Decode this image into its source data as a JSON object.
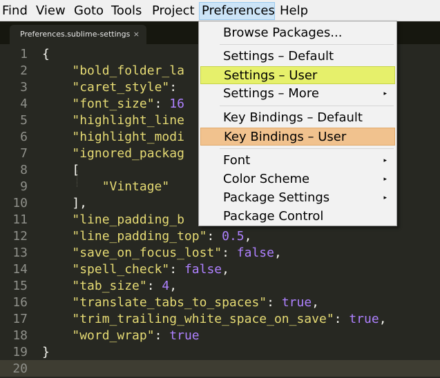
{
  "menubar": {
    "items": [
      {
        "label": "Find"
      },
      {
        "label": "View"
      },
      {
        "label": "Goto"
      },
      {
        "label": "Tools"
      },
      {
        "label": "Project"
      },
      {
        "label": "Preferences"
      },
      {
        "label": "Help"
      }
    ],
    "active": "Preferences"
  },
  "tab": {
    "title": "Preferences.sublime-settings",
    "close": "×"
  },
  "editor": {
    "line_numbers": [
      "1",
      "2",
      "3",
      "4",
      "5",
      "6",
      "7",
      "8",
      "9",
      "10",
      "11",
      "12",
      "13",
      "14",
      "15",
      "16",
      "17",
      "18",
      "19",
      "20"
    ],
    "current_line": 20,
    "lines": [
      [
        {
          "t": "p",
          "v": "{"
        }
      ],
      [
        {
          "t": "p",
          "v": "    "
        },
        {
          "t": "s",
          "v": "\"bold_folder_la"
        }
      ],
      [
        {
          "t": "p",
          "v": "    "
        },
        {
          "t": "s",
          "v": "\"caret_style\""
        },
        {
          "t": "p",
          "v": ":"
        }
      ],
      [
        {
          "t": "p",
          "v": "    "
        },
        {
          "t": "s",
          "v": "\"font_size\""
        },
        {
          "t": "p",
          "v": ": "
        },
        {
          "t": "n",
          "v": "16"
        }
      ],
      [
        {
          "t": "p",
          "v": "    "
        },
        {
          "t": "s",
          "v": "\"highlight_line"
        }
      ],
      [
        {
          "t": "p",
          "v": "    "
        },
        {
          "t": "s",
          "v": "\"highlight_modi"
        }
      ],
      [
        {
          "t": "p",
          "v": "    "
        },
        {
          "t": "s",
          "v": "\"ignored_packag"
        }
      ],
      [
        {
          "t": "p",
          "v": "    ["
        }
      ],
      [
        {
          "t": "p",
          "v": "        "
        },
        {
          "t": "s",
          "v": "\"Vintage\""
        }
      ],
      [
        {
          "t": "p",
          "v": "    ],"
        }
      ],
      [
        {
          "t": "p",
          "v": "    "
        },
        {
          "t": "s",
          "v": "\"line_padding_b"
        }
      ],
      [
        {
          "t": "p",
          "v": "    "
        },
        {
          "t": "s",
          "v": "\"line_padding_top\""
        },
        {
          "t": "p",
          "v": ": "
        },
        {
          "t": "n",
          "v": "0.5"
        },
        {
          "t": "p",
          "v": ","
        }
      ],
      [
        {
          "t": "p",
          "v": "    "
        },
        {
          "t": "s",
          "v": "\"save_on_focus_lost\""
        },
        {
          "t": "p",
          "v": ": "
        },
        {
          "t": "b",
          "v": "false"
        },
        {
          "t": "p",
          "v": ","
        }
      ],
      [
        {
          "t": "p",
          "v": "    "
        },
        {
          "t": "s",
          "v": "\"spell_check\""
        },
        {
          "t": "p",
          "v": ": "
        },
        {
          "t": "b",
          "v": "false"
        },
        {
          "t": "p",
          "v": ","
        }
      ],
      [
        {
          "t": "p",
          "v": "    "
        },
        {
          "t": "s",
          "v": "\"tab_size\""
        },
        {
          "t": "p",
          "v": ": "
        },
        {
          "t": "n",
          "v": "4"
        },
        {
          "t": "p",
          "v": ","
        }
      ],
      [
        {
          "t": "p",
          "v": "    "
        },
        {
          "t": "s",
          "v": "\"translate_tabs_to_spaces\""
        },
        {
          "t": "p",
          "v": ": "
        },
        {
          "t": "b",
          "v": "true"
        },
        {
          "t": "p",
          "v": ","
        }
      ],
      [
        {
          "t": "p",
          "v": "    "
        },
        {
          "t": "s",
          "v": "\"trim_trailing_white_space_on_save\""
        },
        {
          "t": "p",
          "v": ": "
        },
        {
          "t": "b",
          "v": "true"
        },
        {
          "t": "p",
          "v": ","
        }
      ],
      [
        {
          "t": "p",
          "v": "    "
        },
        {
          "t": "s",
          "v": "\"word_wrap\""
        },
        {
          "t": "p",
          "v": ": "
        },
        {
          "t": "b",
          "v": "true"
        }
      ],
      [
        {
          "t": "p",
          "v": "}"
        }
      ],
      []
    ]
  },
  "dropdown": {
    "items": [
      {
        "label": "Browse Packages...",
        "submenu": false,
        "highlight": null
      },
      {
        "label": "Settings – Default",
        "submenu": false,
        "highlight": null
      },
      {
        "label": "Settings – User",
        "submenu": false,
        "highlight": "yellow"
      },
      {
        "label": "Settings – More",
        "submenu": true,
        "highlight": null
      },
      {
        "label": "Key Bindings – Default",
        "submenu": false,
        "highlight": null
      },
      {
        "label": "Key Bindings – User",
        "submenu": false,
        "highlight": "orange"
      },
      {
        "label": "Font",
        "submenu": true,
        "highlight": null
      },
      {
        "label": "Color Scheme",
        "submenu": true,
        "highlight": null
      },
      {
        "label": "Package Settings",
        "submenu": true,
        "highlight": null
      },
      {
        "label": "Package Control",
        "submenu": false,
        "highlight": null
      }
    ],
    "submenu_arrow": "▸",
    "colors": {
      "yellow": "#e6f06b",
      "orange": "#f1c28e"
    }
  },
  "syntax_colors": {
    "string": "#e6db74",
    "number": "#ae81ff",
    "boolean": "#ae81ff",
    "punctuation": "#f8f8f2",
    "background": "#272822"
  }
}
